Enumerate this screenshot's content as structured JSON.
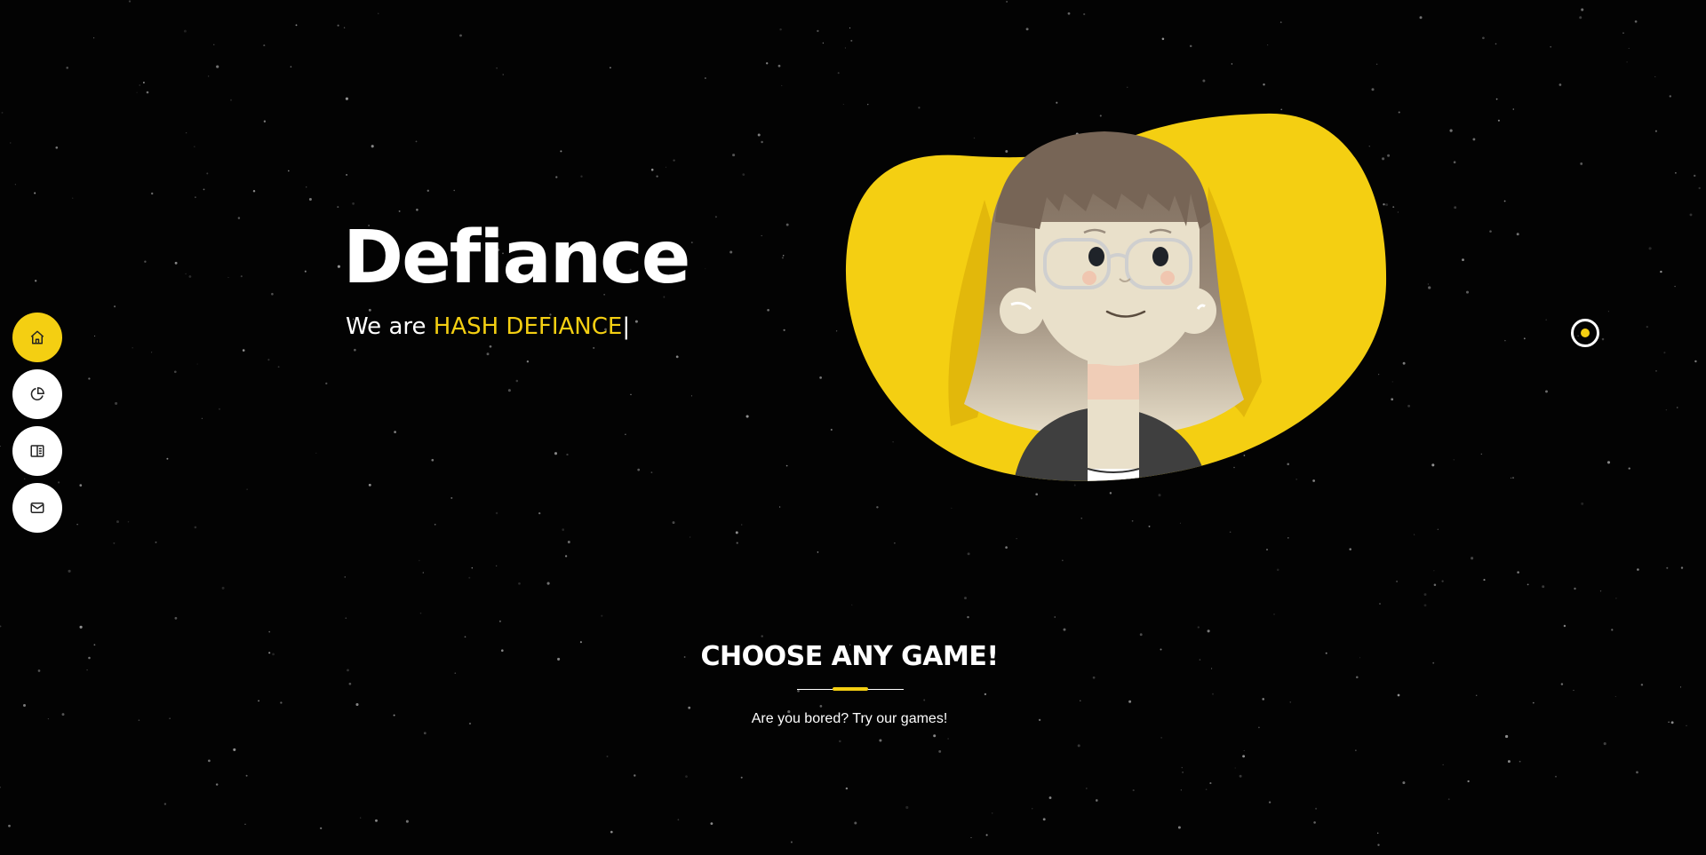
{
  "colors": {
    "background": "#030303",
    "accent": "#f4cf12",
    "text": "#ffffff"
  },
  "side_nav": {
    "items": [
      {
        "icon": "home-icon",
        "active": true
      },
      {
        "icon": "pie-chart-icon",
        "active": false
      },
      {
        "icon": "book-icon",
        "active": false
      },
      {
        "icon": "mail-icon",
        "active": false
      }
    ]
  },
  "hero": {
    "title": "Defiance",
    "subtitle_prefix": "We are ",
    "subtitle_highlight": "HASH DEFIANCE",
    "caret": "|"
  },
  "games_section": {
    "title": "CHOOSE ANY GAME!",
    "subtitle": "Are you bored? Try our games!"
  }
}
